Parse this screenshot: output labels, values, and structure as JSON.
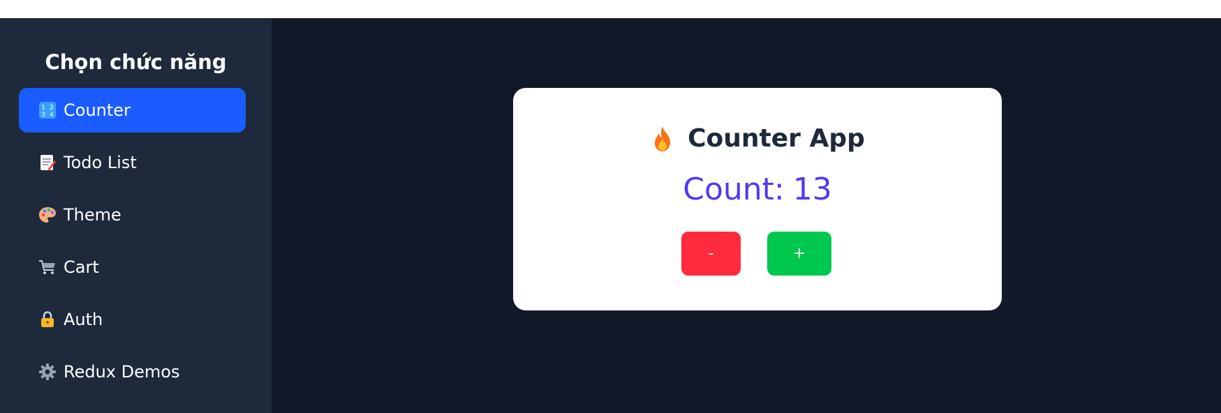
{
  "sidebar": {
    "title": "Chọn chức năng",
    "items": [
      {
        "label": "Counter",
        "icon": "input-numbers-icon",
        "active": true
      },
      {
        "label": "Todo List",
        "icon": "memo-icon",
        "active": false
      },
      {
        "label": "Theme",
        "icon": "palette-icon",
        "active": false
      },
      {
        "label": "Cart",
        "icon": "shopping-cart-icon",
        "active": false
      },
      {
        "label": "Auth",
        "icon": "lock-icon",
        "active": false
      },
      {
        "label": "Redux Demos",
        "icon": "gear-icon",
        "active": false
      }
    ]
  },
  "counter": {
    "title": "Counter App",
    "title_icon": "fire-icon",
    "count_label": "Count:",
    "count_value": 13,
    "decrement_label": "-",
    "increment_label": "+"
  },
  "colors": {
    "sidebar_bg": "#1e293b",
    "main_bg": "#111827",
    "active_item": "#1a5cff",
    "count_text": "#4f39f6",
    "decrement_button": "#ff2a3b",
    "increment_button": "#00c74e"
  }
}
